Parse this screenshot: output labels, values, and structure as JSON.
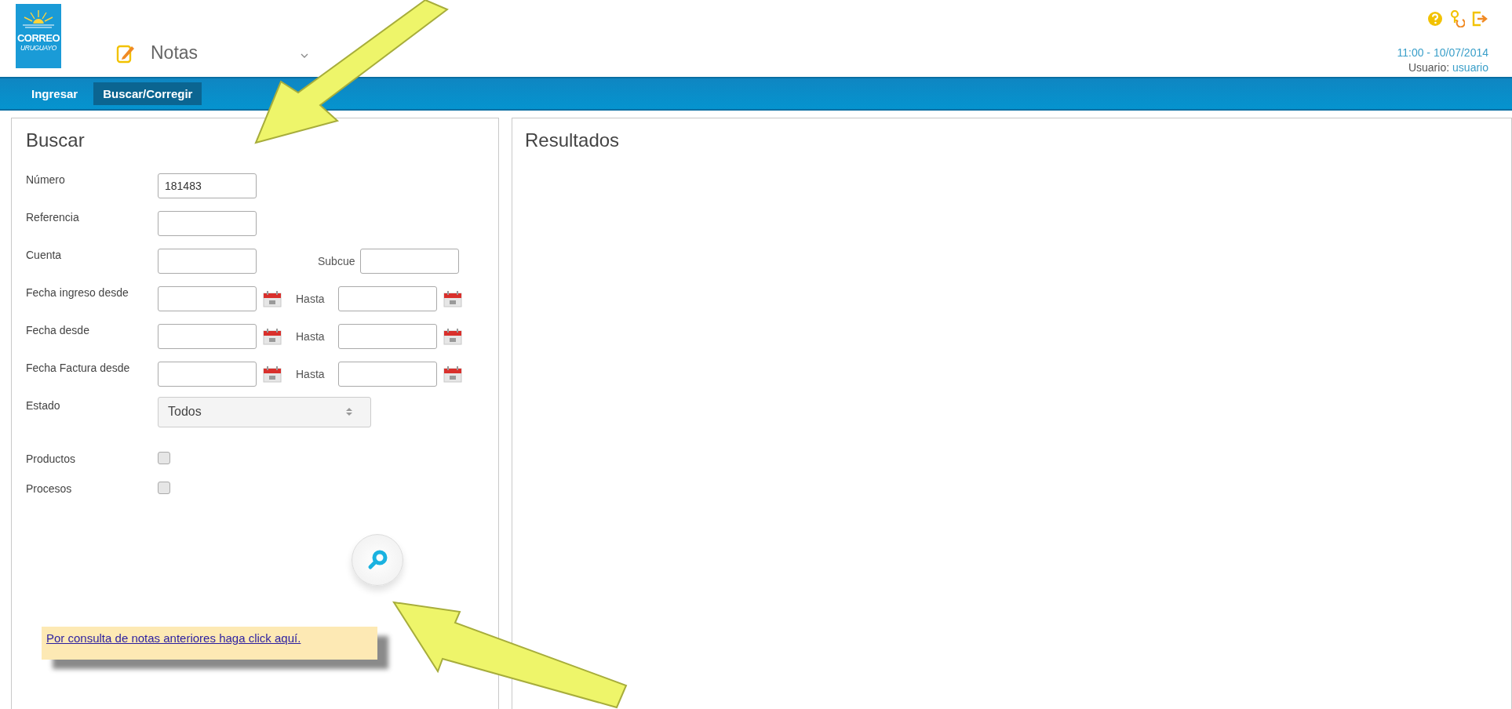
{
  "header": {
    "logo": {
      "title": "CORREO",
      "subtitle": "URUGUAYO"
    },
    "module": "Notas",
    "time": "11:00 - 10/07/2014",
    "user_label": "Usuario:",
    "user": "usuario"
  },
  "nav": [
    {
      "label": "Ingresar",
      "selected": false
    },
    {
      "label": "Buscar/Corregir",
      "selected": true
    }
  ],
  "search_panel": {
    "title": "Buscar",
    "rows": [
      {
        "kind": "text",
        "label": "Número",
        "value": "181483"
      },
      {
        "kind": "text",
        "label": "Referencia"
      },
      {
        "kind": "pair",
        "label": "Cuenta",
        "label_2": "Subcue"
      },
      {
        "kind": "dates",
        "label": "Fecha ingreso desde",
        "label_2": "Hasta"
      },
      {
        "kind": "dates",
        "label": "Fecha desde",
        "label_2": "Hasta"
      },
      {
        "kind": "dates",
        "label": "Fecha Factura desde",
        "label_2": "Hasta"
      },
      {
        "kind": "select",
        "label": "Estado",
        "value": "Todos"
      }
    ],
    "checkboxes": [
      {
        "label": "Productos",
        "checked": false
      },
      {
        "label": "Procesos",
        "checked": false
      }
    ],
    "note_link": "Por consulta de notas anteriores haga click aquí."
  },
  "results_panel": {
    "title": "Resultados"
  }
}
